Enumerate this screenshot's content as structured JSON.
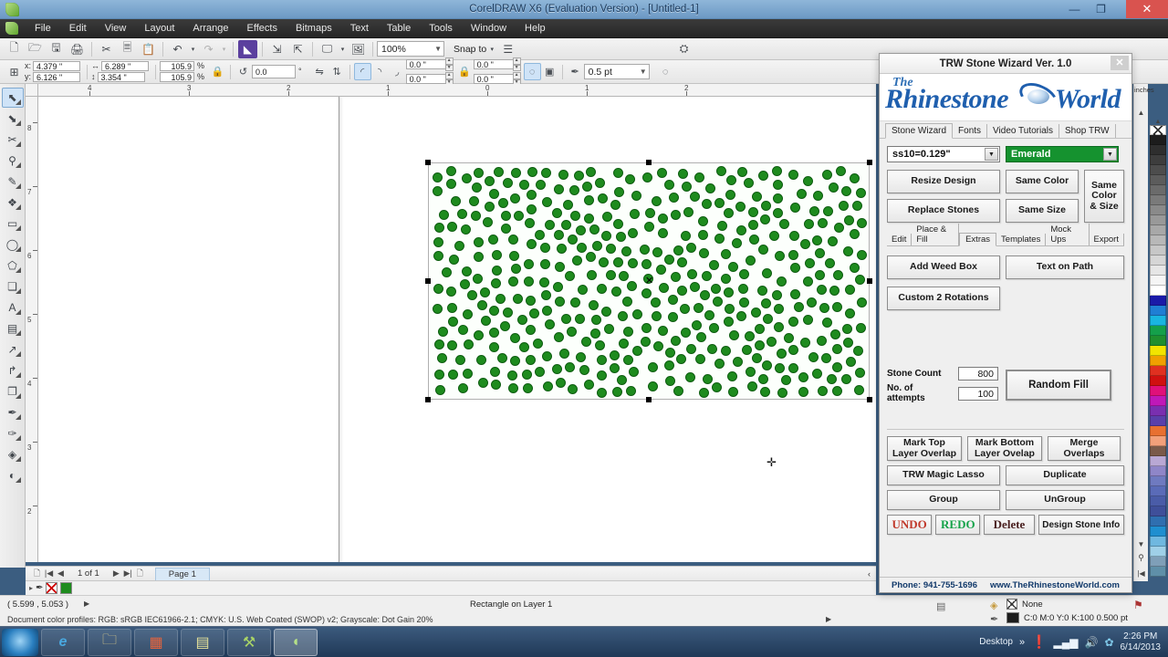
{
  "window": {
    "title": "CorelDRAW X6 (Evaluation Version) - [Untitled-1]",
    "minimize": "—",
    "maximize": "❐",
    "close": "✕"
  },
  "menu": {
    "items": [
      "File",
      "Edit",
      "View",
      "Layout",
      "Arrange",
      "Effects",
      "Bitmaps",
      "Text",
      "Table",
      "Tools",
      "Window",
      "Help"
    ]
  },
  "toolbar": {
    "icons": [
      "new-icon",
      "open-icon",
      "save-icon",
      "print-icon",
      "cut-icon",
      "copy-icon",
      "paste-icon",
      "undo-icon",
      "redo-icon",
      "import-icon",
      "export-icon",
      "publish-pdf-icon",
      "launch-icon",
      "application-icon"
    ],
    "zoom_level": "100%",
    "snap_label": "Snap to",
    "options_icon": "options-icon"
  },
  "propertybar": {
    "x_label": "x:",
    "x_value": "4.379 \"",
    "y_label": "y:",
    "y_value": "6.126 \"",
    "width_value": "6.289 \"",
    "height_value": "3.354 \"",
    "scale_w": "105.9",
    "scale_h": "105.9",
    "percent": "%",
    "lock_icon": "lock-icon",
    "rotation_value": "0.0",
    "degree": "°",
    "mirror_h_icon": "mirror-horizontal-icon",
    "mirror_v_icon": "mirror-vertical-icon",
    "corner_round_icon": "corner-round-icon",
    "corner_scallop_icon": "corner-scallop-icon",
    "corner_chamfer_icon": "corner-chamfer-icon",
    "corner_values": [
      "0.0 \"",
      "0.0 \"",
      "0.0 \"",
      "0.0 \""
    ],
    "edit_corners_icon": "edit-corners-icon",
    "wrap_icon": "text-wrap-icon",
    "outline_icon": "outline-width-icon",
    "outline_width": "0.5 pt",
    "convert_outline_icon": "convert-outline-icon"
  },
  "toolbox": {
    "tools": [
      {
        "name": "pick-tool",
        "glyph": "⬉",
        "selected": true
      },
      {
        "name": "shape-tool",
        "glyph": "⬊",
        "selected": false
      },
      {
        "name": "crop-tool",
        "glyph": "✂",
        "selected": false
      },
      {
        "name": "zoom-tool",
        "glyph": "⚲",
        "selected": false
      },
      {
        "name": "freehand-tool",
        "glyph": "✎",
        "selected": false
      },
      {
        "name": "smart-fill-tool",
        "glyph": "❖",
        "selected": false
      },
      {
        "name": "rectangle-tool",
        "glyph": "▭",
        "selected": false
      },
      {
        "name": "ellipse-tool",
        "glyph": "◯",
        "selected": false
      },
      {
        "name": "polygon-tool",
        "glyph": "⬠",
        "selected": false
      },
      {
        "name": "basic-shapes-tool",
        "glyph": "❏",
        "selected": false
      },
      {
        "name": "text-tool",
        "glyph": "A",
        "selected": false
      },
      {
        "name": "table-tool",
        "glyph": "▤",
        "selected": false
      },
      {
        "name": "dimension-tool",
        "glyph": "↗",
        "selected": false
      },
      {
        "name": "connector-tool",
        "glyph": "↱",
        "selected": false
      },
      {
        "name": "blend-tool",
        "glyph": "❐",
        "selected": false
      },
      {
        "name": "color-eyedropper-tool",
        "glyph": "✒",
        "selected": false
      },
      {
        "name": "outline-tool",
        "glyph": "✑",
        "selected": false
      },
      {
        "name": "fill-tool",
        "glyph": "◈",
        "selected": false
      },
      {
        "name": "interactive-fill-tool",
        "glyph": "◐",
        "selected": false
      }
    ]
  },
  "rulers": {
    "unit": "inches",
    "h_ticks": [
      "4",
      "3",
      "2",
      "1",
      "0",
      "1",
      "2"
    ],
    "v_ticks": [
      "8",
      "7",
      "6",
      "5",
      "4",
      "3",
      "2"
    ]
  },
  "canvas": {
    "selected_object": "rhinestone-design-rectangle",
    "cursor_glyph": "✛"
  },
  "navigator": {
    "first_icon": "first-page-icon",
    "prev_icon": "previous-page-icon",
    "page_count": "1 of 1",
    "next_icon": "next-page-icon",
    "last_icon": "last-page-icon",
    "add_page_icon": "add-page-icon",
    "page_tab": "Page 1"
  },
  "statusbar": {
    "coordinates": "( 5.599 , 5.053 )",
    "object_info": "Rectangle on Layer 1",
    "color_profiles": "Document color profiles: RGB: sRGB IEC61966-2.1; CMYK: U.S. Web Coated (SWOP) v2; Grayscale: Dot Gain 20%",
    "fill_label": "None",
    "outline_value": "C:0 M:0 Y:0 K:100  0.500 pt"
  },
  "trw": {
    "title": "TRW Stone Wizard Ver. 1.0",
    "close": "✕",
    "logo": {
      "the": "The",
      "main": "Rhinestone",
      "main2": "World"
    },
    "tabs": [
      {
        "label": "Stone Wizard",
        "active": true
      },
      {
        "label": "Fonts",
        "active": false
      },
      {
        "label": "Video Tutorials",
        "active": false
      },
      {
        "label": "Shop TRW",
        "active": false
      }
    ],
    "size_select": "ss10=0.129\"",
    "color_select": "Emerald",
    "buttons": {
      "resize_design": "Resize Design",
      "replace_stones": "Replace Stones",
      "same_color": "Same Color",
      "same_size": "Same Size",
      "same_color_size": "Same\nColor\n& Size",
      "add_weed_box": "Add Weed Box",
      "text_on_path": "Text on Path",
      "custom_2_rotations": "Custom 2 Rotations",
      "random_fill": "Random Fill",
      "mark_top": "Mark Top\nLayer Overlap",
      "mark_bottom": "Mark Bottom\nLayer Ovelap",
      "merge_overlaps": "Merge\nOverlaps",
      "magic_lasso": "TRW Magic Lasso",
      "duplicate": "Duplicate",
      "group": "Group",
      "ungroup": "UnGroup",
      "undo": "UNDO",
      "redo": "REDO",
      "delete": "Delete",
      "design_stone_info": "Design Stone Info"
    },
    "subtabs": [
      {
        "label": "Edit",
        "active": false
      },
      {
        "label": "Place & Fill",
        "active": false
      },
      {
        "label": "Extras",
        "active": true
      },
      {
        "label": "Templates",
        "active": false
      },
      {
        "label": "Mock Ups",
        "active": false
      },
      {
        "label": "Export",
        "active": false
      }
    ],
    "stone_count_label": "Stone  Count",
    "stone_count_value": "800",
    "attempts_label": "No. of attempts",
    "attempts_value": "100",
    "footer": {
      "phone": "Phone: 941-755-1696",
      "website": "www.TheRhinestoneWorld.com"
    }
  },
  "taskbar": {
    "start_icon": "start-orb-icon",
    "apps": [
      {
        "name": "internet-explorer-icon",
        "glyph": "e",
        "active": false
      },
      {
        "name": "file-explorer-icon",
        "glyph": "🗀",
        "active": false
      },
      {
        "name": "media-app-icon",
        "glyph": "▦",
        "active": false
      },
      {
        "name": "notes-app-icon",
        "glyph": "▤",
        "active": false
      },
      {
        "name": "utility-app-icon",
        "glyph": "⚒",
        "active": false
      },
      {
        "name": "coreldraw-icon",
        "glyph": "◖",
        "active": true
      }
    ],
    "show_desktop": "Desktop",
    "overflow": "»",
    "alert_icon": "alert-icon",
    "network_icon": "network-icon",
    "volume_icon": "volume-icon",
    "shield_icon": "security-icon",
    "time": "2:26 PM",
    "date": "6/14/2013"
  },
  "colors": {
    "stone_fill": "#1e8b1e",
    "stone_stroke": "#0d5c10",
    "accent_green": "#15922f",
    "logo_blue": "#1f5fae",
    "undo_red": "#c0392b",
    "redo_green": "#16a34a"
  },
  "palette": {
    "none_swatch": "none-swatch",
    "swatches": [
      "#1c1c1c",
      "#2e2e2e",
      "#3d3d3d",
      "#4d4d4d",
      "#5c5c5c",
      "#6b6b6b",
      "#7a7a7a",
      "#8a8a8a",
      "#999999",
      "#a8a8a8",
      "#b8b8b8",
      "#c7c7c7",
      "#d6d6d6",
      "#e6e6e6",
      "#f5f5f5",
      "#ffffff",
      "#1a1aa8",
      "#1f7fd4",
      "#19b5e0",
      "#14a04a",
      "#1f8f2e",
      "#f2e400",
      "#f0a000",
      "#e03020",
      "#d01010",
      "#e0107a",
      "#c018b8",
      "#7a2fb0",
      "#5a3faa",
      "#e87030",
      "#f2a07a",
      "#7a5a4a",
      "#b9a8d4",
      "#8f86c8",
      "#6f7ac0",
      "#5a6bb8",
      "#4a5ca8",
      "#3f4f9a",
      "#2f6fb0",
      "#1f8fd0",
      "#6fb8e0",
      "#9fd0e8",
      "#7f9fb8",
      "#5f8fa8"
    ]
  }
}
